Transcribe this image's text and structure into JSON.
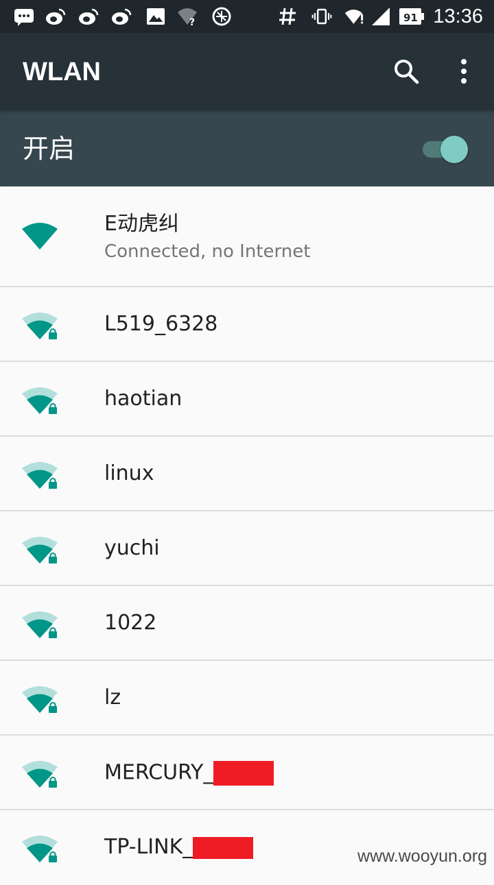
{
  "status_bar": {
    "time": "13:36",
    "battery_level": "91",
    "icons": [
      "chat-icon",
      "weibo-icon",
      "weibo-icon",
      "weibo-icon",
      "image-icon",
      "wifi-unknown-icon",
      "browser-icon",
      "hash-icon",
      "vibrate-icon",
      "wifi-icon",
      "signal-icon",
      "battery-icon"
    ]
  },
  "app_bar": {
    "title": "WLAN",
    "search_icon": "search-icon",
    "menu_icon": "more-vert-icon"
  },
  "wifi_switch": {
    "label": "开启",
    "state": "on"
  },
  "networks": [
    {
      "name": "E动虎纠",
      "status": "Connected, no Internet",
      "secured": false,
      "connected": true
    },
    {
      "name": "L519_6328",
      "secured": true
    },
    {
      "name": "haotian",
      "secured": true
    },
    {
      "name": "linux",
      "secured": true
    },
    {
      "name": "yuchi",
      "secured": true
    },
    {
      "name": "1022",
      "secured": true
    },
    {
      "name": "lz",
      "secured": true
    },
    {
      "name": "MERCURY_",
      "secured": true,
      "redacted_suffix": true
    },
    {
      "name": "TP-LINK_",
      "secured": true,
      "redacted_suffix": true
    }
  ],
  "watermark": "www.wooyun.org",
  "colors": {
    "status_bar": "#1f272c",
    "app_bar": "#263238",
    "switch_bar": "#37474f",
    "accent": "#009688",
    "redaction": "#ee1c25"
  }
}
